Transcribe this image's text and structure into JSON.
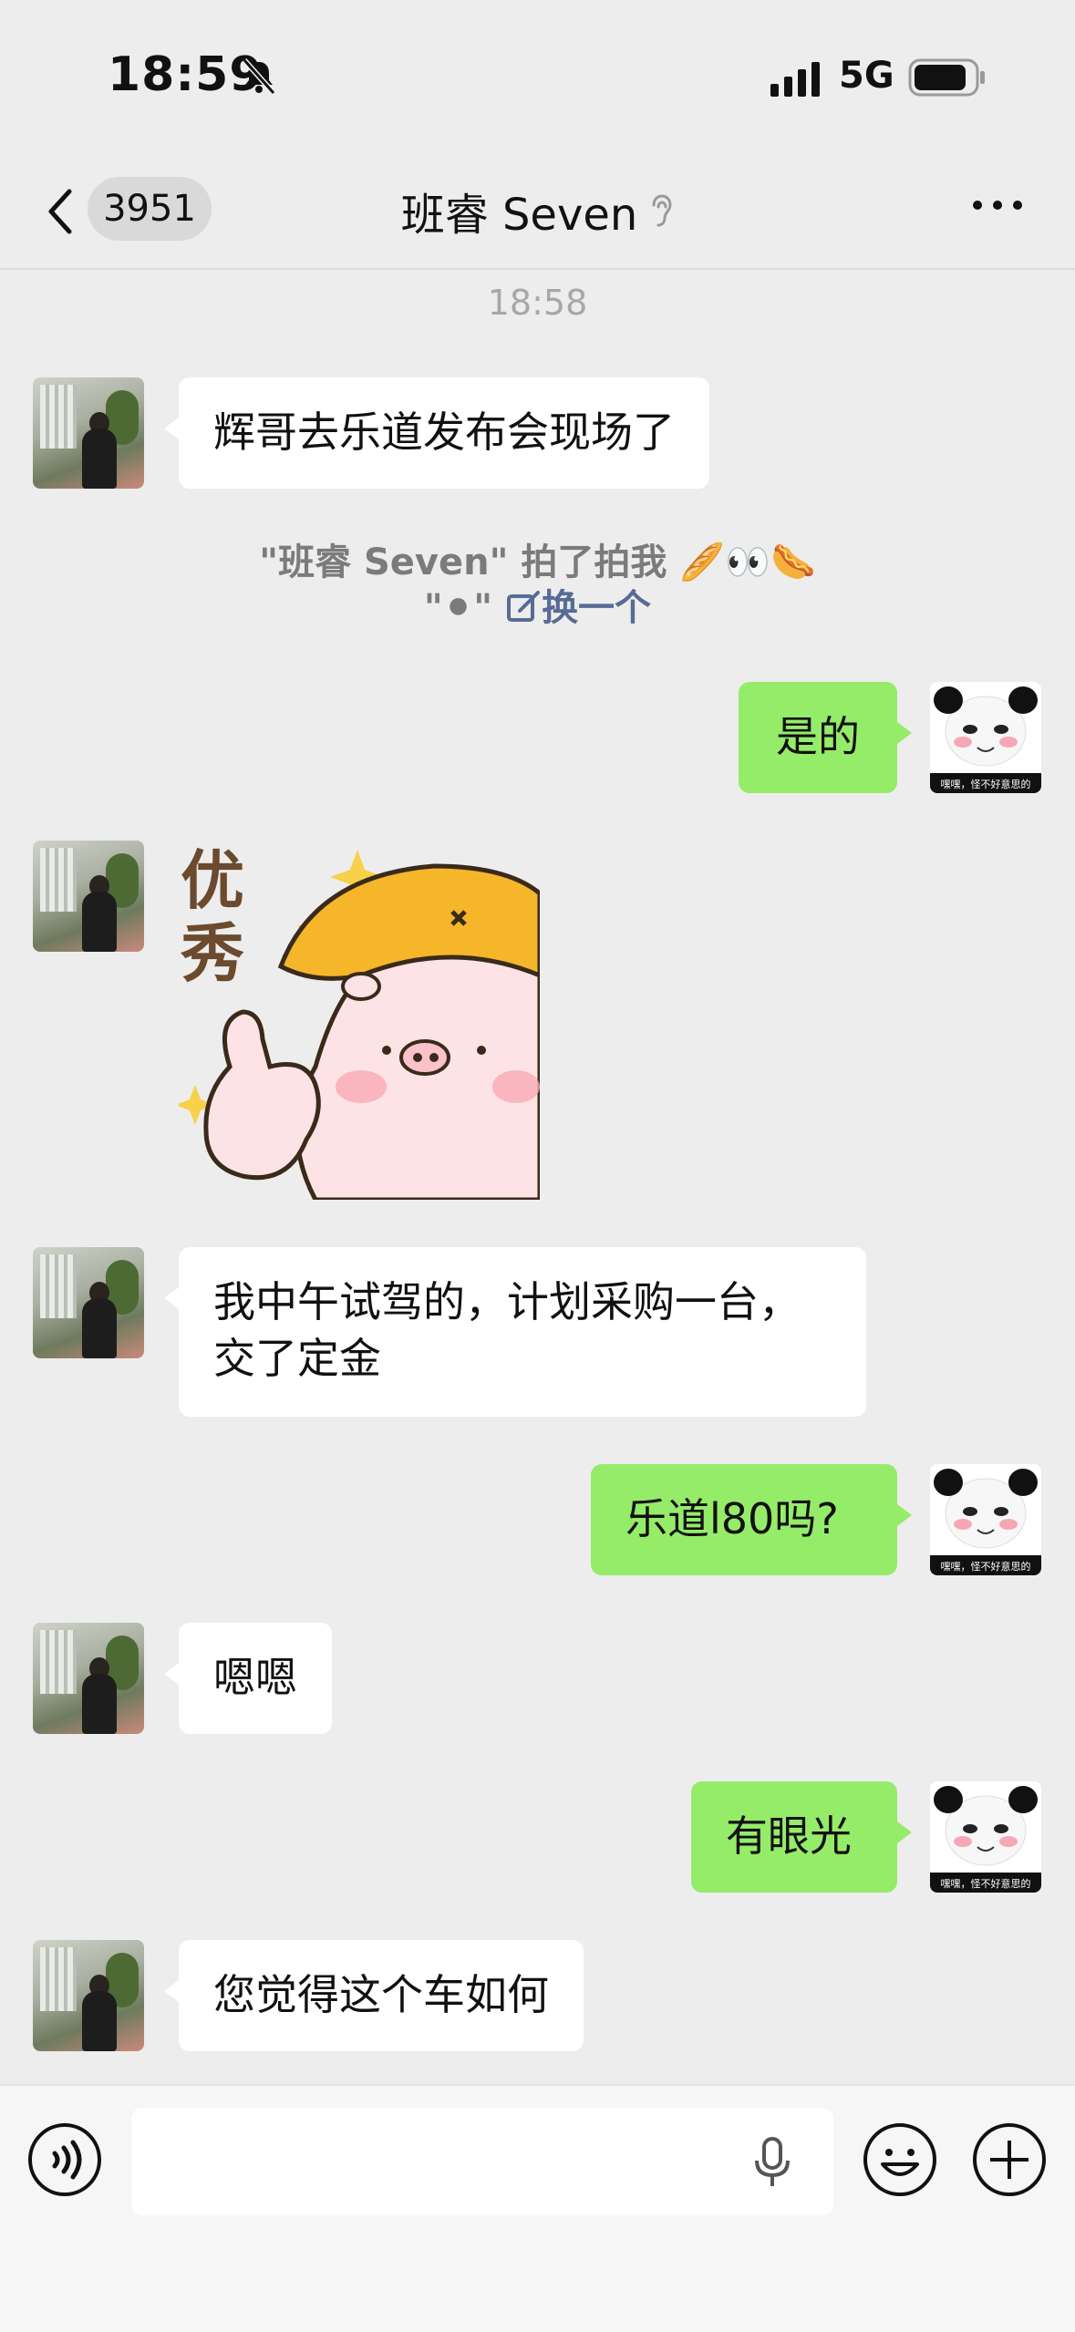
{
  "status_bar": {
    "time": "18:59",
    "network": "5G",
    "icons": [
      "bell-slash-icon",
      "signal-icon",
      "battery-icon"
    ]
  },
  "nav": {
    "unread_count": "3951",
    "title": "班睿 Seven",
    "icons": [
      "back-icon",
      "ear-icon",
      "more-icon"
    ]
  },
  "time_separator": "18:58",
  "messages": [
    {
      "from": "friend",
      "type": "text",
      "text": "辉哥去乐道发布会现场了"
    },
    {
      "from": "me",
      "type": "text",
      "text": "是的"
    },
    {
      "from": "friend",
      "type": "sticker",
      "sticker_text": "优秀"
    },
    {
      "from": "friend",
      "type": "text",
      "line1": "我中午试驾的，计划采购一台，",
      "line2": "交了定金"
    },
    {
      "from": "me",
      "type": "text",
      "text": "乐道l80吗?"
    },
    {
      "from": "friend",
      "type": "text",
      "text": "嗯嗯"
    },
    {
      "from": "me",
      "type": "text",
      "text": "有眼光"
    },
    {
      "from": "friend",
      "type": "text",
      "text": "您觉得这个车如何"
    }
  ],
  "pat_notice": {
    "line1": "\"班睿 Seven\" 拍了拍我",
    "emoji_suffix": "🥖👀🌭",
    "line2_prefix": "\"⚫\"",
    "change_link": "换一个"
  },
  "my_avatar_caption": "嘿嘿，怪不好意思的",
  "input_bar": {
    "placeholder": "",
    "icons": [
      "voice-icon",
      "mic-icon",
      "emoji-icon",
      "plus-icon"
    ]
  },
  "colors": {
    "background": "#ededed",
    "outgoing_bubble": "#95ec69",
    "incoming_bubble": "#ffffff",
    "link": "#576b95"
  }
}
